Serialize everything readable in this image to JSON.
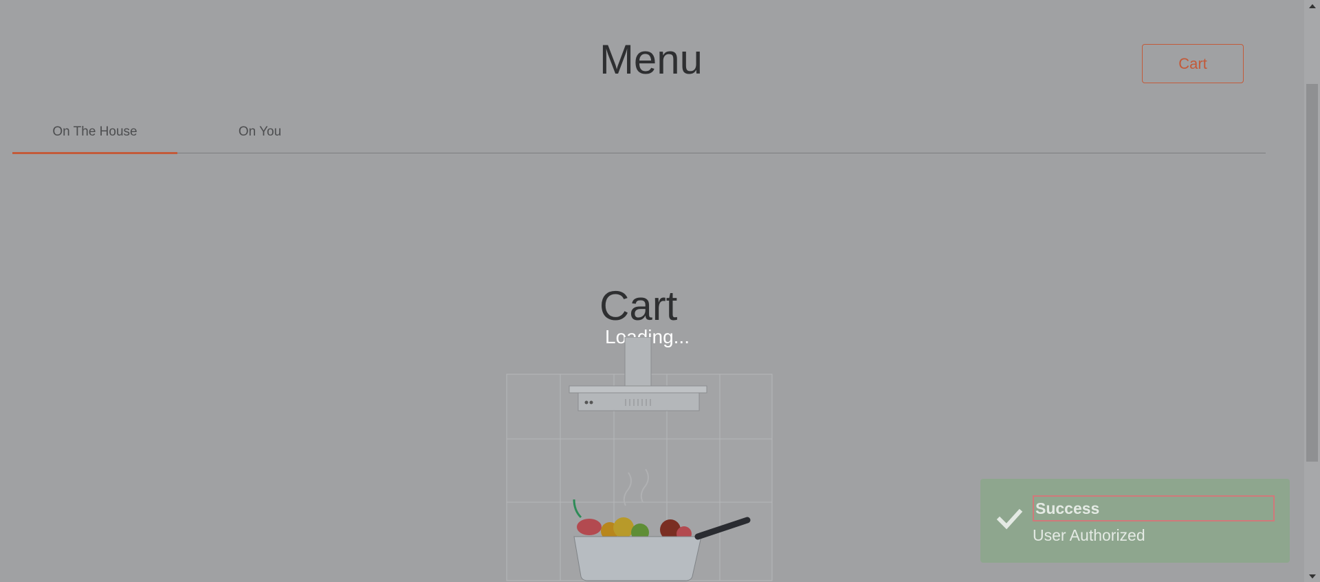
{
  "header": {
    "title": "Menu",
    "cart_button": "Cart"
  },
  "tabs": [
    {
      "label": "On The House",
      "active": true
    },
    {
      "label": "On You",
      "active": false
    }
  ],
  "cart_panel": {
    "heading": "Cart",
    "loading_text": "Loading..."
  },
  "toast": {
    "title": "Success",
    "message": "User Authorized",
    "icon": "check-icon"
  },
  "colors": {
    "accent": "#c35a39",
    "overlay_bg": "#a0a1a3",
    "toast_bg": "#8ea68e"
  }
}
